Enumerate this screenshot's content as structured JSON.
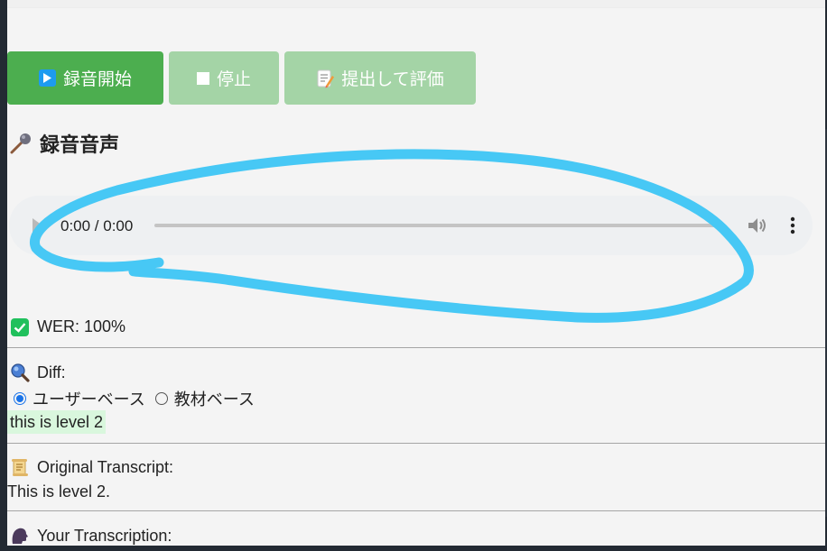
{
  "toolbar": {
    "start_label": "録音開始",
    "stop_label": "停止",
    "submit_label": "提出して評価"
  },
  "recording": {
    "title": "録音音声",
    "player": {
      "time": "0:00 / 0:00"
    }
  },
  "wer": {
    "label": "WER: 100%"
  },
  "diff": {
    "label": "Diff:",
    "options": [
      {
        "label": "ユーザーベース",
        "selected": true
      },
      {
        "label": "教材ベース",
        "selected": false
      }
    ],
    "text": "this is level 2"
  },
  "original": {
    "label": "Original Transcript:",
    "text": "This is level 2."
  },
  "yours": {
    "label": "Your Transcription:"
  },
  "colors": {
    "start_button": "#4cae4f",
    "disabled_button": "#a4d4a6",
    "annotation_stroke": "#47c8f5",
    "diff_highlight": "#d9f7dd"
  }
}
